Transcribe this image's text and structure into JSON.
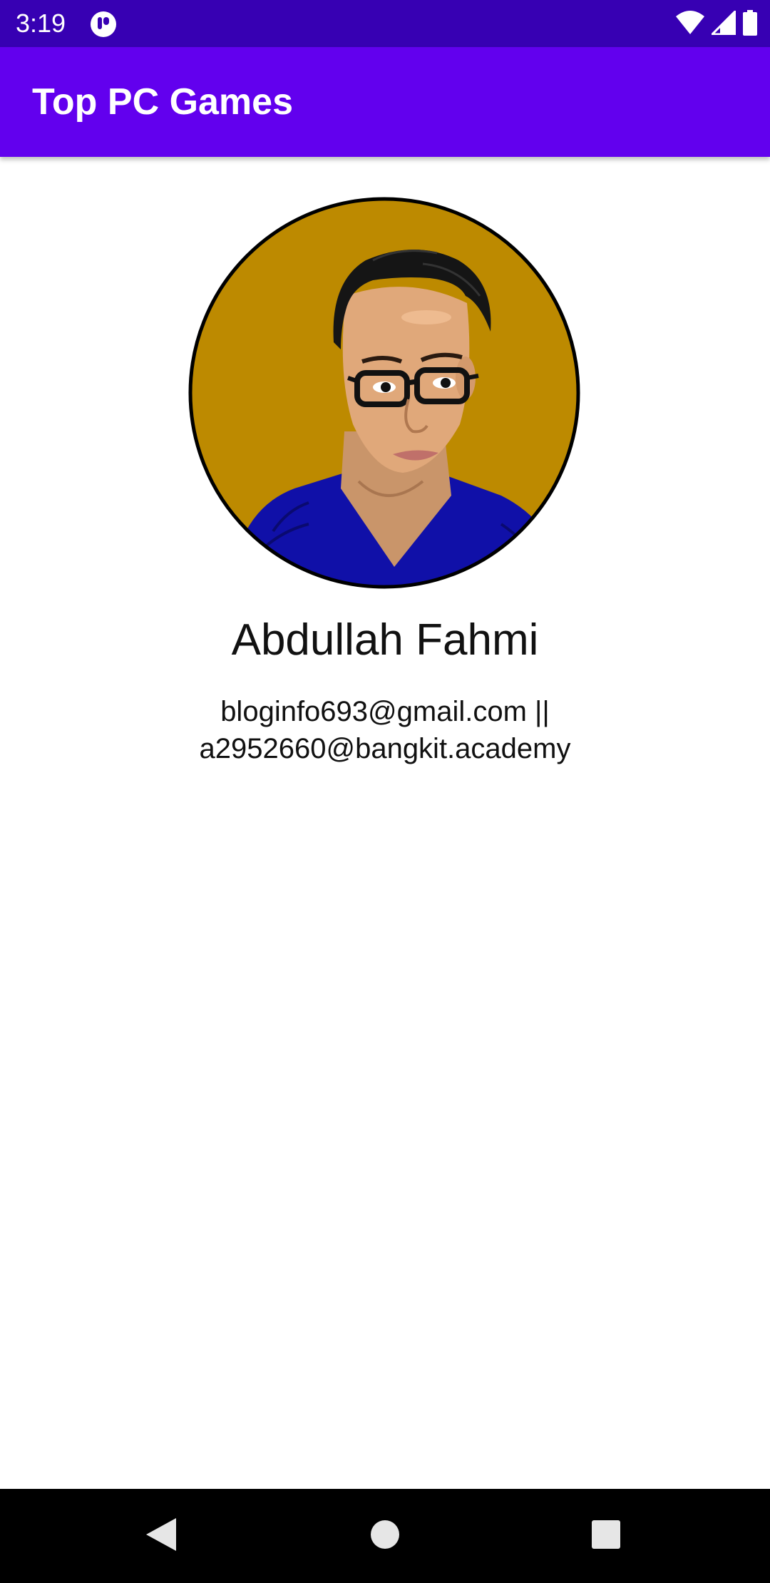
{
  "status_bar": {
    "time": "3:19",
    "icons": [
      "app-notification-icon",
      "wifi-icon",
      "cellular-signal-icon",
      "battery-icon"
    ]
  },
  "app_bar": {
    "title": "Top PC Games",
    "color": "#6200EE"
  },
  "profile": {
    "name": "Abdullah Fahmi",
    "email_line_1": "bloginfo693@gmail.com ||",
    "email_line_2": "a2952660@bangkit.academy",
    "avatar_background": "#BD8A00"
  },
  "nav_bar": {
    "buttons": [
      "back-icon",
      "home-icon",
      "recents-icon"
    ]
  }
}
